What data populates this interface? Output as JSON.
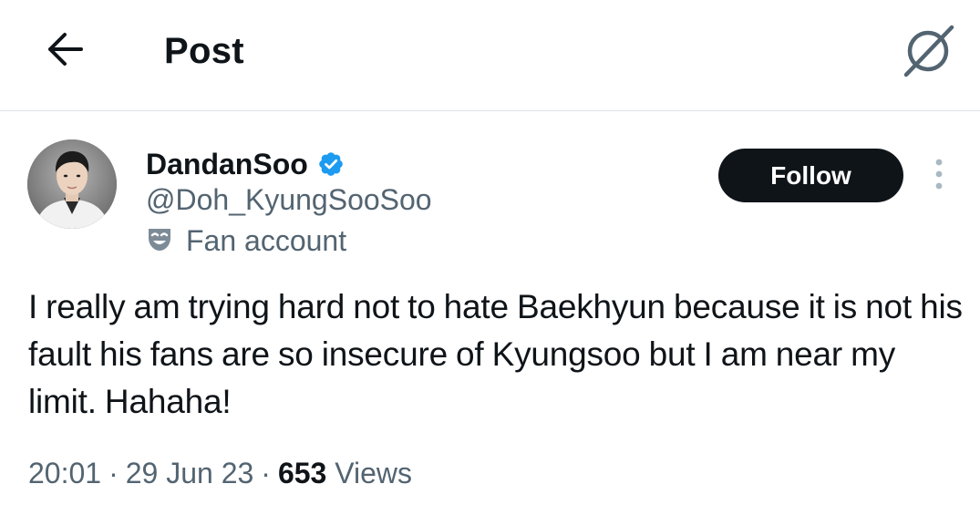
{
  "header": {
    "title": "Post",
    "back_icon": "arrow-left-icon",
    "grok_icon": "grok-icon"
  },
  "author": {
    "display_name": "DandanSoo",
    "handle": "@Doh_KyungSooSoo",
    "verified_icon": "verified-badge-icon",
    "verified_color": "#1d9bf0",
    "label_icon": "theater-mask-icon",
    "label": "Fan account",
    "avatar": "avatar"
  },
  "actions": {
    "follow_label": "Follow",
    "more_icon": "more-vertical-icon"
  },
  "post": {
    "text": "I really am trying hard not to hate Baekhyun because it is not his fault his fans are so insecure of Kyungsoo but I am near my limit. Hahaha!",
    "time": "20:01",
    "separator": "·",
    "date": "29 Jun 23",
    "views_count": "653",
    "views_label": "Views"
  },
  "colors": {
    "text_primary": "#0f1419",
    "text_secondary": "#536471",
    "button_bg": "#0f1419",
    "divider": "#dde3e8"
  }
}
